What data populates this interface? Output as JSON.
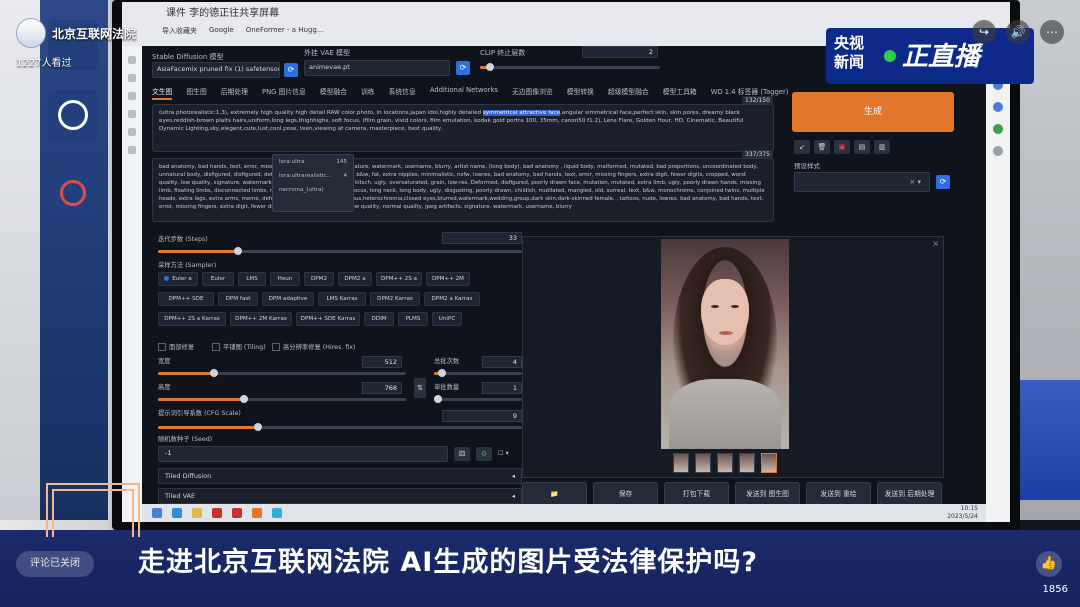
{
  "overlay": {
    "channel_name": "北京互联网法院",
    "viewers": "1227人看过",
    "cctv_top": "央视",
    "cctv_bottom": "新闻",
    "live_label": "正直播",
    "caption": "走进北京互联网法院 AI生成的图片受法律保护吗?",
    "comment_status": "评论已关闭",
    "like_count": "1856",
    "icons": [
      "share-icon",
      "volume-icon",
      "more-icon",
      "like-icon"
    ]
  },
  "browser": {
    "tab_title": "课件 李的德正往共享屏幕",
    "bookmarks": [
      "导入收藏夹",
      "Google",
      "OneFormer - a Hugg..."
    ]
  },
  "webui": {
    "checkpoint_label": "Stable Diffusion 模型",
    "checkpoint_value": "AsiaFacemix pruned fix (1) safetensors [7520b...",
    "vae_label": "外挂 VAE 模型",
    "vae_value": "animevae.pt",
    "clip_label": "CLIP 终止层数",
    "clip_value": "2",
    "tabs": [
      "文生图",
      "图生图",
      "后期处理",
      "PNG 图片信息",
      "模型融合",
      "训练",
      "系统信息",
      "Additional Networks",
      "无边图像浏览",
      "模型转换",
      "超级模型融合",
      "模型工具箱",
      "WD 1.4 标签器 (Tagger)"
    ],
    "prompt": {
      "counter": "132/150",
      "text_before": "(ultra photorealistic:1.3), extremely high quality high detail RAW color photo, in locations,japan idol,highly detailed ",
      "text_highlight": "symmetrical attractive face",
      "text_after": ",angular simmetrical face,perfect skin, skin pores, dreamy black eyes,reddish-brown plaits hairs,uniform,long legs,thighhighs, soft focus, (film grain, vivid colors, film emulation, kodak gold portra 100, 35mm, canon50 f1.2), Lens Flare, Golden Hour, HD, Cinematic, Beautiful Dynamic Lighting,sky,elegent,cute,lust,cool pose, teen,viewing at camera, masterpiece, best quality,"
    },
    "negative": {
      "counter": "337/375",
      "text": "bad anatomy, bad hands, text, error, missing fingers, worst quality, signature, watermark, username, blurry, artist name, (long body), bad anatomy , liquid body, malformed, mutated, bad proportions, uncoordinated body, unnatural body, disfigured, disfigured, deformed, (mutation), (child:1.2), b&w, fat, extra nipples, minimalistic, nsfw, lowres, bad anatomy, bad hands, text, error, missing fingers, extra digit, fewer digits, cropped, worst quality, low quality, signature, watermark, username, blurry, disfigured, kitsch, ugly, oversaturated, grain, low-res, Deformed, disfigured, poorly drawn face, mutation, mutated, extra limb, ugly, poorly drawn hands, missing limb, floating limbs, disconnected limbs, malformed hands, blur, out of focus, long neck, long body, ugly, disgusting, poorly drawn, childish, mutilated, mangled, old, surreal, text, b&w, monochrome, conjoined twins, multiple heads, extra legs, extra arms, meme, deformed,twisted,fingers,strabismus,heterochromia,closed eyes,blurred,watermark,wedding,group,dark skin,dark-skinned female, , tattoos, nude, lowres, bad anatomy, bad hands, text, error, missing fingers, extra digit, fewer digits, cropped, worst quality, low quality, normal quality, jpeg artifacts, signature, watermark, username, blurry"
    },
    "autocomplete": [
      {
        "label": "lora:ultra",
        "count": "145"
      },
      {
        "label": "lora:ultrarealistic...",
        "count": "4"
      },
      {
        "label": "necroma_(ultra)",
        "count": ""
      }
    ],
    "generate_label": "生成",
    "tool_icons": [
      "arrow-icon",
      "trash-icon",
      "clipboard-icon",
      "style-icon",
      "save-style-icon"
    ],
    "style_label": "预设样式",
    "style_clear": "× ▾",
    "steps_label": "迭代步数 (Steps)",
    "steps_value": "33",
    "steps_pct": 0.22,
    "sampler_label": "采样方法 (Sampler)",
    "samplers_row1": [
      "Euler a",
      "Euler",
      "LMS",
      "Heun",
      "DPM2",
      "DPM2 a",
      "DPM++ 2S a",
      "DPM++ 2M"
    ],
    "samplers_row2": [
      "DPM++ SDE",
      "DPM fast",
      "DPM adaptive",
      "LMS Karras",
      "DPM2 Karras",
      "DPM2 a Karras"
    ],
    "samplers_row3": [
      "DPM++ 2S a Karras",
      "DPM++ 2M Karras",
      "DPM++ SDE Karras",
      "DDIM",
      "PLMS",
      "UniPC"
    ],
    "options": [
      "面部修复",
      "平铺图 (Tiling)",
      "高分辨率修复 (Hires. fix)"
    ],
    "width_label": "宽度",
    "width_value": "512",
    "height_label": "高度",
    "height_value": "768",
    "batch_count_label": "总批次数",
    "batch_count_value": "4",
    "batch_size_label": "单批数量",
    "batch_size_value": "1",
    "cfg_label": "提示词引导系数 (CFG Scale)",
    "cfg_value": "9",
    "seed_label": "随机数种子 (Seed)",
    "seed_value": "-1",
    "accordions": [
      "Tiled Diffusion",
      "Tiled VAE"
    ],
    "actions": [
      "📁",
      "保存",
      "打包下载",
      "发送到 图生图",
      "发送到 重绘",
      "发送到 后期处理"
    ]
  },
  "taskbar": {
    "time": "10:15",
    "date": "2023/5/24"
  }
}
